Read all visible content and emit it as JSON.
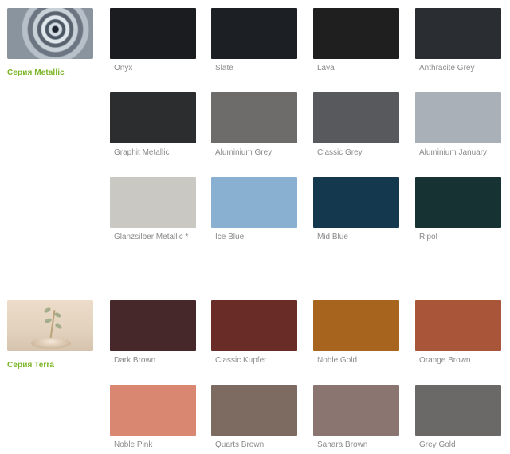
{
  "series": [
    {
      "title": "Серия Metallic",
      "swatches": [
        {
          "name": "Onyx",
          "color": "#1b1c1f"
        },
        {
          "name": "Slate",
          "color": "#1c1f24"
        },
        {
          "name": "Lava",
          "color": "#1f1f20"
        },
        {
          "name": "Anthracite Grey",
          "color": "#2a2d31"
        },
        {
          "name": "Graphit Metallic",
          "color": "#2c2d2f"
        },
        {
          "name": "Aluminium Grey",
          "color": "#6d6c6b"
        },
        {
          "name": "Classic Grey",
          "color": "#58595d"
        },
        {
          "name": "Aluminium January",
          "color": "#a9b0b7"
        },
        {
          "name": "Glanzsilber Metallic *",
          "color": "#c9c8c3"
        },
        {
          "name": "Ice Blue",
          "color": "#89b0d1"
        },
        {
          "name": "Mid Blue",
          "color": "#14384e"
        },
        {
          "name": "Ripol",
          "color": "#173233"
        }
      ]
    },
    {
      "title": "Серия Terra",
      "swatches": [
        {
          "name": "Dark Brown",
          "color": "#46282a"
        },
        {
          "name": "Classic Kupfer",
          "color": "#6a2c26"
        },
        {
          "name": "Noble Gold",
          "color": "#a7641e"
        },
        {
          "name": "Orange Brown",
          "color": "#a9553a"
        },
        {
          "name": "Noble Pink",
          "color": "#d98770"
        },
        {
          "name": "Quarts Brown",
          "color": "#7d6b61"
        },
        {
          "name": "Sahara Brown",
          "color": "#8a7570"
        },
        {
          "name": "Grey Gold",
          "color": "#6b6868"
        }
      ]
    }
  ]
}
